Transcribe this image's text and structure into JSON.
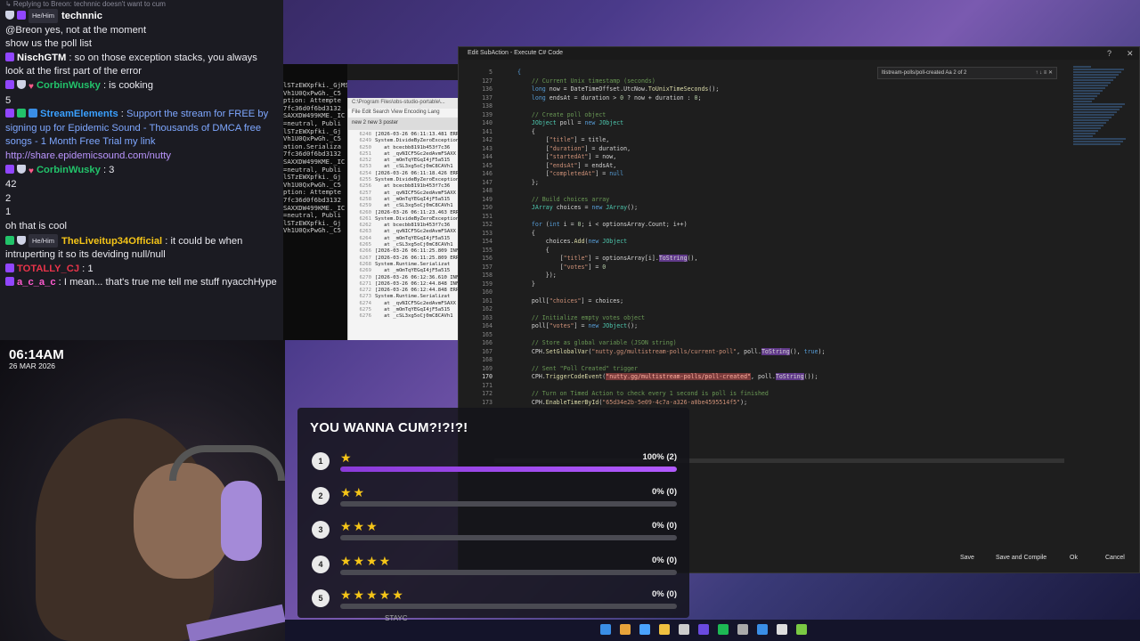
{
  "chat": {
    "messages": [
      {
        "reply": "Replying to Breon: technnic doesn't want to cum",
        "pronoun": "He/Him",
        "user": "technnic",
        "text": "",
        "color": "#ffffff",
        "badges": [
          "shield",
          "purple"
        ]
      },
      {
        "text": "@Breon yes, not at the moment"
      },
      {
        "text": "show us the poll list"
      },
      {
        "user": "NischGTM",
        "text": "so on those exception stacks, you always look at the first part of the error",
        "color": "#ffffff",
        "badges": [
          "purple"
        ]
      },
      {
        "user": "CorbinWusky",
        "text": "is cooking",
        "color": "#22c36a",
        "badges": [
          "purple",
          "shield",
          "heart"
        ]
      },
      {
        "text": "5"
      },
      {
        "user": "StreamElements",
        "text": "Support the stream for FREE by signing up for Epidemic Sound - Thousands of DMCA free songs - 1 Month Free Trial my link",
        "link": "http://share.epidemicsound.com/nutty",
        "color": "#3aa0ff",
        "badges": [
          "purple",
          "green",
          "blue"
        ]
      },
      {
        "user": "CorbinWusky",
        "text": "3",
        "color": "#22c36a",
        "badges": [
          "purple",
          "shield",
          "heart"
        ]
      },
      {
        "text": "42"
      },
      {
        "text": "2"
      },
      {
        "text": "1"
      },
      {
        "text": "oh that is cool"
      },
      {
        "pronoun": "He/Him",
        "user": "TheLiveitup34Official",
        "text": "it could be when intruperting it so its deviding null/null",
        "color": "#f5c518",
        "badges": [
          "green",
          "shield"
        ]
      },
      {
        "user": "TOTALLY_CJ",
        "text": "1",
        "color": "#e8344a",
        "badges": [
          "purple"
        ]
      },
      {
        "user": "a_c_a_c",
        "text": "I mean... that's true me tell me stuff nyacchHype",
        "color": "#ff5bd0",
        "badges": [
          "purple"
        ]
      }
    ]
  },
  "overlay": {
    "clock": "06:14AM",
    "date": "26 MAR 2026"
  },
  "notepad": {
    "title": "C:\\Program Files\\obs-studio-portable\\...",
    "menu": "File  Edit  Search  View  Encoding  Lang",
    "tabs": "new 2      new 3      poster",
    "lines": [
      {
        "n": "6248",
        "t": "[2026-03-26 06:11:13.481 ERR"
      },
      {
        "n": "6249",
        "t": "System.DivideByZeroException:"
      },
      {
        "n": "6250",
        "t": "   at bcecbb8191b453f7c36"
      },
      {
        "n": "6251",
        "t": "   at _qvNICF5Gc2edAvmFSAXX"
      },
      {
        "n": "6252",
        "t": "   at _mOmTqYEGqI4jF5a515"
      },
      {
        "n": "6253",
        "t": "   at _cSL3xg5oCj0mC8CAVh1"
      },
      {
        "n": "6254",
        "t": "[2026-03-26 06:11:18.426 ERR"
      },
      {
        "n": "6255",
        "t": "System.DivideByZeroException:"
      },
      {
        "n": "6256",
        "t": "   at bcecbb8191b453f7c36"
      },
      {
        "n": "6257",
        "t": "   at _qvNICF5Gc2edAvmFSAXX"
      },
      {
        "n": "6258",
        "t": "   at _mOmTqYEGqI4jF5a515"
      },
      {
        "n": "6259",
        "t": "   at _cSL3xg5oCj0mC8CAVh1"
      },
      {
        "n": "6260",
        "t": "[2026-03-26 06:11:23.463 ERR"
      },
      {
        "n": "6261",
        "t": "System.DivideByZeroException:"
      },
      {
        "n": "6262",
        "t": "   at bcecbb8191b453f7c36"
      },
      {
        "n": "6263",
        "t": "   at _qvNICF5Gc2edAvmFSAXX"
      },
      {
        "n": "6264",
        "t": "   at _mOmTqYEGqI4jF5a515"
      },
      {
        "n": "6265",
        "t": "   at _cSL3xg5oCj0mC8CAVh1"
      },
      {
        "n": "6266",
        "t": "[2026-03-26 06:11:25.809 INF"
      },
      {
        "n": "6267",
        "t": "[2026-03-26 06:11:25.809 ERR"
      },
      {
        "n": "6268",
        "t": "System.Runtime.Serializat"
      },
      {
        "n": "6269",
        "t": "   at _mOmTqYEGqI4jF5a515"
      },
      {
        "n": "6270",
        "t": "[2026-03-26 06:12:36.610 INF"
      },
      {
        "n": "6271",
        "t": "[2026-03-26 06:12:44.848 INF"
      },
      {
        "n": "6272",
        "t": "[2026-03-26 06:12:44.848 ERR"
      },
      {
        "n": "6273",
        "t": "System.Runtime.Serializat"
      },
      {
        "n": "6274",
        "t": "   at _qvNICF5Gc2edAvmFSAXX"
      },
      {
        "n": "6275",
        "t": "   at _mOmTqYEGqI4jF5a515"
      },
      {
        "n": "6276",
        "t": "   at _cSL3xg5oCj0mC8CAVh1"
      }
    ]
  },
  "terminal": {
    "lines": [
      "lSTzEWXpfki._GjMSMDhB6F",
      "",
      "Vh1U0QxPwGh._C5",
      "ption: Attempte",
      "7fc36d0f6bd3132",
      "SAXXDW499KME._IC",
      "=neutral, Publi",
      "lSTzEWXpfki._Gj",
      "",
      "Vh1U0QxPwGh._C5",
      "ation.Serializa",
      "7fc36d0f6bd3132",
      "SAXXDW499KME._IC",
      "=neutral, Publi",
      "lSTzEWXpfki._Gj",
      "",
      "Vh1U0QxPwGh._C5",
      "ption: Attempte",
      "7fc36d0f6bd3132",
      "SAXXDW499KME._IC",
      "=neutral, Publi",
      "lSTzEWXpfki._Gj",
      "",
      "Vh1U0QxPwGh._C5"
    ]
  },
  "editor": {
    "title": "Edit SubAction - Execute C# Code",
    "find_text": "ltistream-polls/poll-created  Aa  2 of 2",
    "buttons": {
      "save": "Save",
      "save_compile": "Save and Compile",
      "ok": "Ok",
      "cancel": "Cancel"
    },
    "code": [
      {
        "n": "5",
        "html": "<span class=\"kw\">{</span>"
      },
      {
        "n": "127",
        "html": "    <span class=\"cm\">// Current Unix timestamp (seconds)</span>"
      },
      {
        "n": "136",
        "html": "    <span class=\"kw\">long</span> now = DateTimeOffset.UtcNow.<span class=\"fn\">ToUnixTimeSeconds</span>();"
      },
      {
        "n": "137",
        "html": "    <span class=\"kw\">long</span> endsAt = duration &gt; <span class=\"nm\">0</span> ? now + duration : <span class=\"nm\">0</span>;"
      },
      {
        "n": "138",
        "html": ""
      },
      {
        "n": "139",
        "html": "    <span class=\"cm\">// Create poll object</span>"
      },
      {
        "n": "140",
        "html": "    <span class=\"ty\">JObject</span> poll = <span class=\"kw\">new</span> <span class=\"ty\">JObject</span>"
      },
      {
        "n": "141",
        "html": "    {"
      },
      {
        "n": "142",
        "html": "        [<span class=\"st\">\"title\"</span>] = title,"
      },
      {
        "n": "143",
        "html": "        [<span class=\"st\">\"duration\"</span>] = duration,"
      },
      {
        "n": "144",
        "html": "        [<span class=\"st\">\"startedAt\"</span>] = now,"
      },
      {
        "n": "145",
        "html": "        [<span class=\"st\">\"endsAt\"</span>] = endsAt,"
      },
      {
        "n": "146",
        "html": "        [<span class=\"st\">\"completedAt\"</span>] = <span class=\"kw\">null</span>"
      },
      {
        "n": "147",
        "html": "    };"
      },
      {
        "n": "148",
        "html": ""
      },
      {
        "n": "149",
        "html": "    <span class=\"cm\">// Build choices array</span>"
      },
      {
        "n": "150",
        "html": "    <span class=\"ty\">JArray</span> choices = <span class=\"kw\">new</span> <span class=\"ty\">JArray</span>();"
      },
      {
        "n": "151",
        "html": ""
      },
      {
        "n": "152",
        "html": "    <span class=\"kw\">for</span> (<span class=\"kw\">int</span> i = <span class=\"nm\">0</span>; i &lt; optionsArray.Count; i++)"
      },
      {
        "n": "153",
        "html": "    {"
      },
      {
        "n": "154",
        "html": "        choices.<span class=\"fn\">Add</span>(<span class=\"kw\">new</span> <span class=\"ty\">JObject</span>"
      },
      {
        "n": "155",
        "html": "        {"
      },
      {
        "n": "156",
        "html": "            [<span class=\"st\">\"title\"</span>] = optionsArray[i].<span class=\"hl\">ToString</span>(),"
      },
      {
        "n": "157",
        "html": "            [<span class=\"st\">\"votes\"</span>] = <span class=\"nm\">0</span>"
      },
      {
        "n": "158",
        "html": "        });"
      },
      {
        "n": "159",
        "html": "    }"
      },
      {
        "n": "160",
        "html": ""
      },
      {
        "n": "161",
        "html": "    poll[<span class=\"st\">\"choices\"</span>] = choices;"
      },
      {
        "n": "162",
        "html": ""
      },
      {
        "n": "163",
        "html": "    <span class=\"cm\">// Initialize empty votes object</span>"
      },
      {
        "n": "164",
        "html": "    poll[<span class=\"st\">\"votes\"</span>] = <span class=\"kw\">new</span> <span class=\"ty\">JObject</span>();"
      },
      {
        "n": "165",
        "html": ""
      },
      {
        "n": "166",
        "html": "    <span class=\"cm\">// Store as global variable (JSON string)</span>"
      },
      {
        "n": "167",
        "html": "    CPH.<span class=\"fn\">SetGlobalVar</span>(<span class=\"st\">\"nutty.gg/multistream-polls/current-poll\"</span>, poll.<span class=\"hl\">ToString</span>(), <span class=\"kw\">true</span>);"
      },
      {
        "n": "168",
        "html": ""
      },
      {
        "n": "169",
        "html": "    <span class=\"cm\">// Sent \"Poll Created\" trigger</span>"
      },
      {
        "n": "170",
        "html": "    CPH.<span class=\"fn\">TriggerCodeEvent</span>(<span class=\"hls\">\"nutty.gg/multistream-polls/poll-created\"</span>, poll.<span class=\"hl\">ToString</span>());",
        "cur": true
      },
      {
        "n": "171",
        "html": ""
      },
      {
        "n": "172",
        "html": "    <span class=\"cm\">// Turn on Timed Action to check every 1 second is poll is finished</span>"
      },
      {
        "n": "173",
        "html": "    CPH.<span class=\"fn\">EnableTimerById</span>(<span class=\"st\">\"65d34e2b-5e09-4c7a-a326-a0be4595514f5\"</span>);"
      }
    ]
  },
  "poll": {
    "title": "YOU WANNA CUM?!?!?!",
    "options": [
      {
        "num": "1",
        "stars": 1,
        "pct_text": "100% (2)",
        "fill": 1.0
      },
      {
        "num": "2",
        "stars": 2,
        "pct_text": "0% (0)",
        "fill": 0.0
      },
      {
        "num": "3",
        "stars": 3,
        "pct_text": "0% (0)",
        "fill": 0.0
      },
      {
        "num": "4",
        "stars": 4,
        "pct_text": "0% (0)",
        "fill": 0.0
      },
      {
        "num": "5",
        "stars": 5,
        "pct_text": "0% (0)",
        "fill": 0.0
      }
    ]
  },
  "background": {
    "music_artist": "STAYC"
  },
  "colors": {
    "poll_fill": "#b25aff",
    "accent": "#9146ff"
  }
}
